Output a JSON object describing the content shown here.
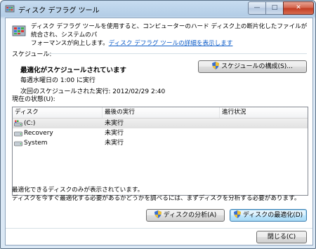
{
  "window": {
    "title": "ディスク デフラグ ツール",
    "minimize_label": "—",
    "maximize_label": "□",
    "close_label": "✕"
  },
  "header": {
    "text_line1": "ディスク デフラグ ツールを使用すると、コンピューターのハード ディスク上の断片化したファイルが統合され、システムのパ",
    "text_line2_prefix": "フォーマンスが向上します。",
    "help_link": "ディスク デフラグ ツールの詳細を表示します"
  },
  "schedule": {
    "section_label": "スケジュール:",
    "status_title": "最適化がスケジュールされています",
    "frequency": "毎週水曜日の 1:00 に実行",
    "next_run": "次回のスケジュールされた実行: 2012/02/29 2:40",
    "configure_button": "スケジュールの構成(S)..."
  },
  "current_status": {
    "section_label": "現在の状態(U):",
    "columns": [
      "ディスク",
      "最後の実行",
      "進行状況"
    ],
    "rows": [
      {
        "disk": "(C:)",
        "last_run": "未実行",
        "progress": "",
        "icon": "system-drive-icon"
      },
      {
        "disk": "Recovery",
        "last_run": "未実行",
        "progress": "",
        "icon": "hard-drive-icon"
      },
      {
        "disk": "System",
        "last_run": "未実行",
        "progress": "",
        "icon": "hard-drive-icon"
      }
    ]
  },
  "footer": {
    "note_line1": "最適化できるディスクのみが表示されています。",
    "note_line2": "ディスクを今すぐ最適化する必要があるかどうかを調べるには、まずディスクを分析する必要があります。",
    "analyze_button": "ディスクの分析(A)",
    "defrag_button": "ディスクの最適化(D)",
    "close_button": "閉じる(C)"
  },
  "colors": {
    "link": "#0b5bc8",
    "title_bar": "#b3cde6",
    "close_button": "#c13b22",
    "selected_row": "#e1e1e1"
  }
}
